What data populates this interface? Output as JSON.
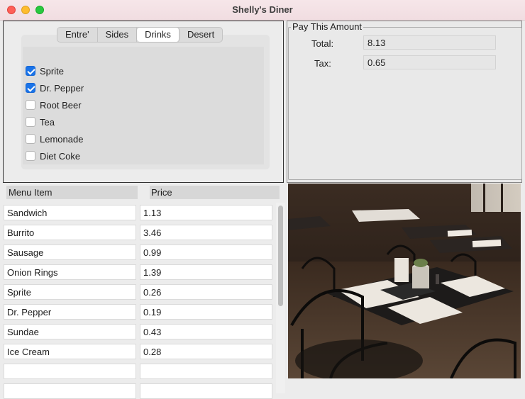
{
  "window": {
    "title": "Shelly's Diner"
  },
  "tabs": [
    "Entre'",
    "Sides",
    "Drinks",
    "Desert"
  ],
  "active_tab": "Drinks",
  "drinks": [
    {
      "label": "Sprite",
      "checked": true
    },
    {
      "label": "Dr. Pepper",
      "checked": true
    },
    {
      "label": "Root Beer",
      "checked": false
    },
    {
      "label": "Tea",
      "checked": false
    },
    {
      "label": "Lemonade",
      "checked": false
    },
    {
      "label": "Diet Coke",
      "checked": false
    }
  ],
  "payment": {
    "legend": "Pay This Amount",
    "total_label": "Total:",
    "total_value": "8.13",
    "tax_label": "Tax:",
    "tax_value": "0.65"
  },
  "table": {
    "headers": [
      "Menu Item",
      "Price"
    ],
    "rows": [
      [
        "Sandwich",
        "1.13"
      ],
      [
        "Burrito",
        "3.46"
      ],
      [
        "Sausage",
        "0.99"
      ],
      [
        "Onion Rings",
        "1.39"
      ],
      [
        "Sprite",
        "0.26"
      ],
      [
        "Dr. Pepper",
        "0.19"
      ],
      [
        "Sundae",
        "0.43"
      ],
      [
        "Ice Cream",
        "0.28"
      ],
      [
        "",
        ""
      ],
      [
        "",
        ""
      ]
    ]
  },
  "colors": {
    "accent": "#1a73e8"
  },
  "image": {
    "subject": "restaurant-interior-photo"
  }
}
